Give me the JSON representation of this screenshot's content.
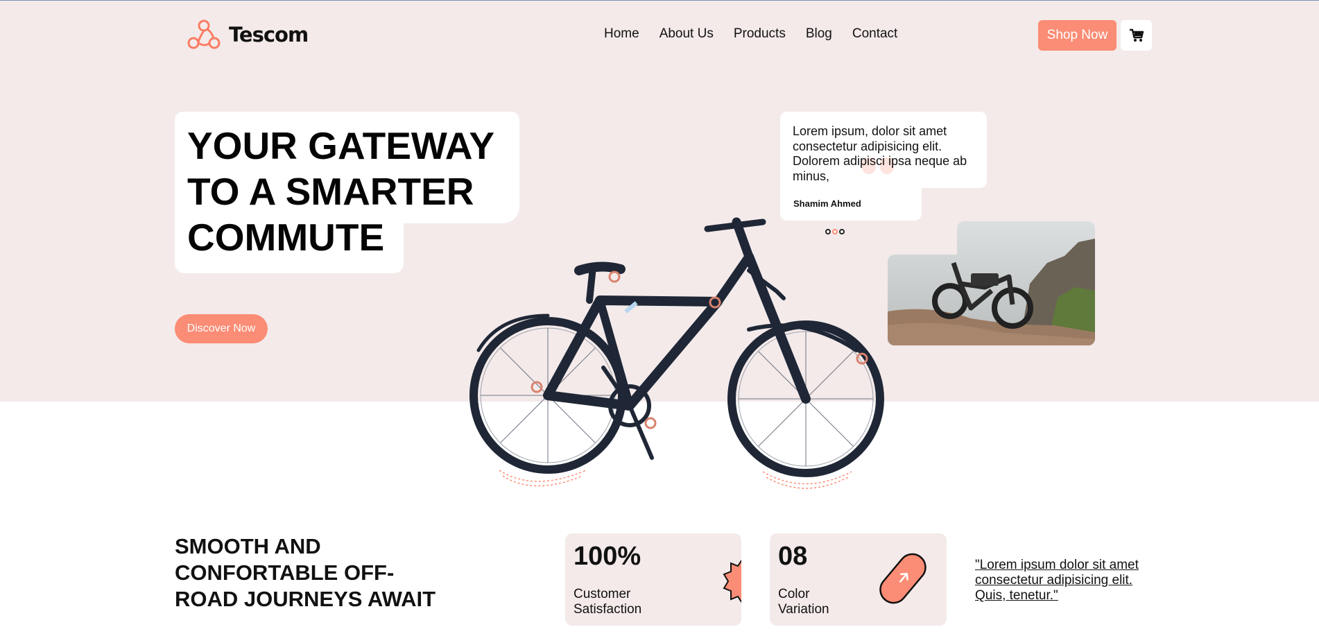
{
  "brand": {
    "name": "Tescom",
    "logo_icon": "tri-circle-logo-icon",
    "accent": "#fb8c75"
  },
  "nav": {
    "items": [
      "Home",
      "About Us",
      "Products",
      "Blog",
      "Contact"
    ]
  },
  "header": {
    "shop_label": "Shop Now",
    "cart_icon": "cart-icon"
  },
  "hero": {
    "headline": [
      "YOUR GATEWAY",
      "TO A SMARTER",
      "COMMUTE"
    ],
    "cta_label": "Discover Now",
    "testimonial": {
      "text": "Lorem ipsum, dolor sit amet consectetur adipisicing elit. Dolorem adipisci ipsa neque ab minus,",
      "author": "Shamim Ahmed",
      "active_dot": 1,
      "dot_count": 3
    }
  },
  "section": {
    "tagline": [
      "SMOOTH AND",
      "CONFORTABLE OFF-",
      "ROAD JOURNEYS AWAIT"
    ],
    "stats": [
      {
        "value": "100%",
        "label_lines": [
          "Customer",
          "Satisfaction"
        ]
      },
      {
        "value": "08",
        "label_lines": [
          "Color",
          "Variation"
        ]
      }
    ],
    "quote_link": "\"Lorem ipsum dolor sit amet consectetur adipisicing elit. Quis, tenetur.\""
  }
}
